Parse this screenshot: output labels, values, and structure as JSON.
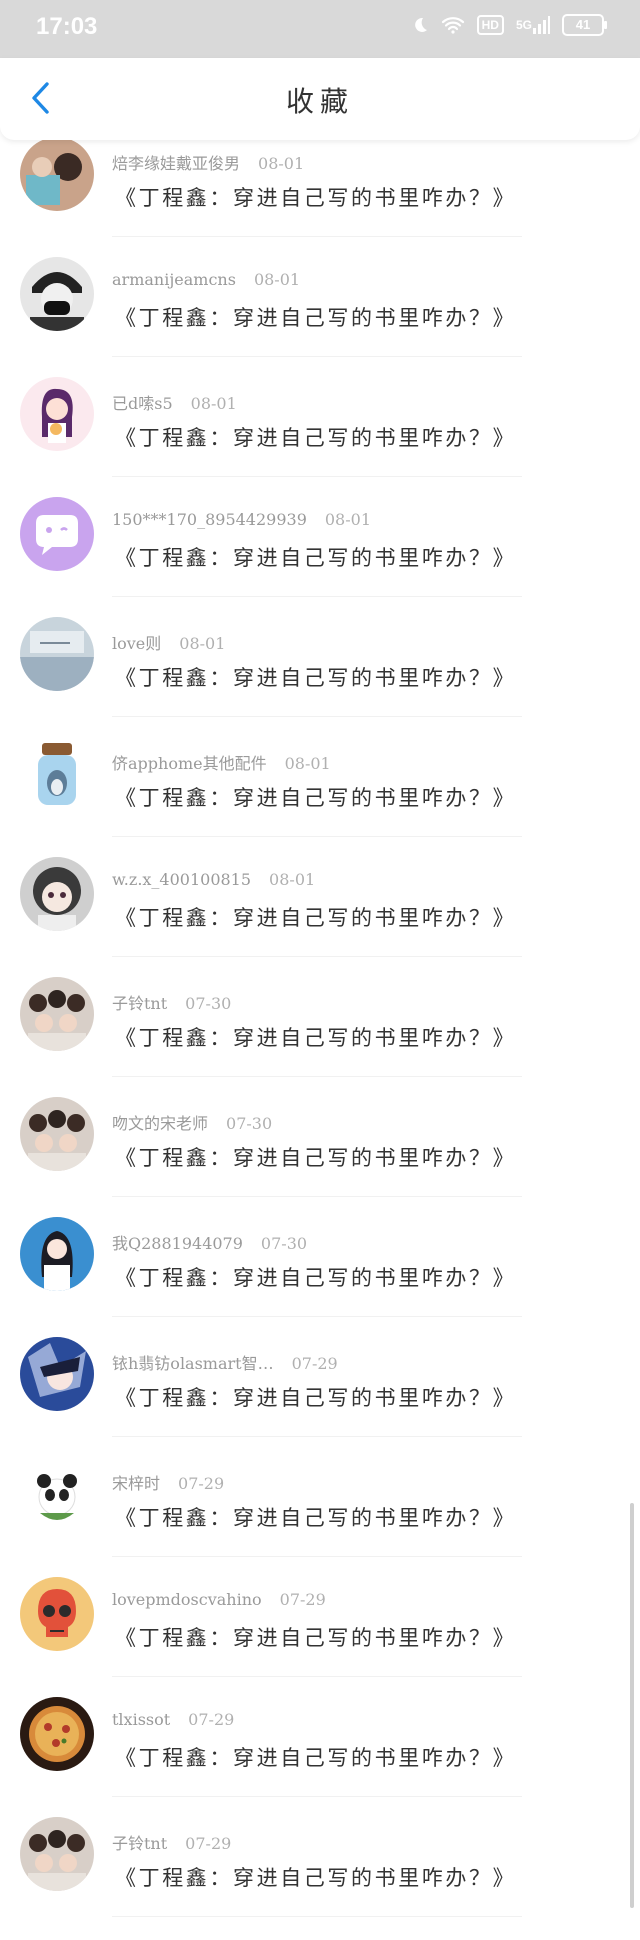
{
  "status_bar": {
    "time": "17:03",
    "hd": "HD",
    "network": "5G",
    "battery": "41"
  },
  "header": {
    "title": "收藏",
    "back_icon": "chevron-left-icon",
    "accent_color": "#1e88e5"
  },
  "items": [
    {
      "username": "焙李缘娃戴亚俊男",
      "date": "08-01",
      "title": "《丁程鑫：穿进自己写的书里咋办？》",
      "avatar": "photo-avatar"
    },
    {
      "username": "armanijeamcns",
      "date": "08-01",
      "title": "《丁程鑫：穿进自己写的书里咋办？》",
      "avatar": "masked-person-avatar"
    },
    {
      "username": "已d嗦s5",
      "date": "08-01",
      "title": "《丁程鑫：穿进自己写的书里咋办？》",
      "avatar": "anime-girl-avatar"
    },
    {
      "username": "150***170_8954429939",
      "date": "08-01",
      "title": "《丁程鑫：穿进自己写的书里咋办？》",
      "avatar": "default-chat-avatar"
    },
    {
      "username": "love则",
      "date": "08-01",
      "title": "《丁程鑫：穿进自己写的书里咋办？》",
      "avatar": "scenery-avatar"
    },
    {
      "username": "侪apphome其他配件",
      "date": "08-01",
      "title": "《丁程鑫：穿进自己写的书里咋办？》",
      "avatar": "bottle-avatar"
    },
    {
      "username": "w.z.x_400100815",
      "date": "08-01",
      "title": "《丁程鑫：穿进自己写的书里咋办？》",
      "avatar": "anime-doll-avatar"
    },
    {
      "username": "子铃tnt",
      "date": "07-30",
      "title": "《丁程鑫：穿进自己写的书里咋办？》",
      "avatar": "group-photo-avatar"
    },
    {
      "username": "吻文的宋老师",
      "date": "07-30",
      "title": "《丁程鑫：穿进自己写的书里咋办？》",
      "avatar": "group-photo-avatar"
    },
    {
      "username": "我Q2881944079",
      "date": "07-30",
      "title": "《丁程鑫：穿进自己写的书里咋办？》",
      "avatar": "girl-blue-avatar"
    },
    {
      "username": "铱h翡钫olasmart智…",
      "date": "07-29",
      "title": "《丁程鑫：穿进自己写的书里咋办？》",
      "avatar": "anime-blue-avatar"
    },
    {
      "username": "宋梓时",
      "date": "07-29",
      "title": "《丁程鑫：穿进自己写的书里咋办？》",
      "avatar": "panda-avatar"
    },
    {
      "username": "lovepmdoscvahino",
      "date": "07-29",
      "title": "《丁程鑫：穿进自己写的书里咋办？》",
      "avatar": "skull-avatar"
    },
    {
      "username": "tlxissot",
      "date": "07-29",
      "title": "《丁程鑫：穿进自己写的书里咋办？》",
      "avatar": "pizza-avatar"
    },
    {
      "username": "子铃tnt",
      "date": "07-29",
      "title": "《丁程鑫：穿进自己写的书里咋办？》",
      "avatar": "group-photo-avatar"
    }
  ]
}
